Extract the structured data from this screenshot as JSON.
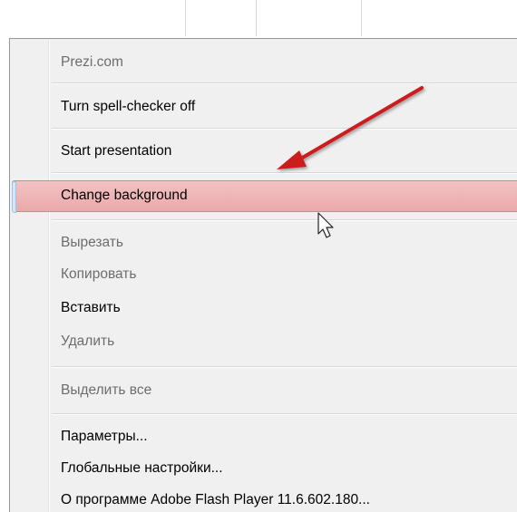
{
  "menu": {
    "items": {
      "prezi": "Prezi.com",
      "spell": "Turn spell-checker off",
      "start": "Start presentation",
      "change_bg": "Change background",
      "cut": "Вырезать",
      "copy": "Копировать",
      "paste": "Вставить",
      "delete": "Удалить",
      "select_all": "Выделить все",
      "params": "Параметры...",
      "global": "Глобальные настройки...",
      "about": "О программе Adobe Flash Player 11.6.602.180..."
    }
  },
  "annotation": {
    "arrow_color": "#cc1f1f"
  },
  "colors": {
    "menu_bg": "#f0f0f0",
    "highlight": "#eeb2b4",
    "disabled_text": "#6d6d6d"
  }
}
